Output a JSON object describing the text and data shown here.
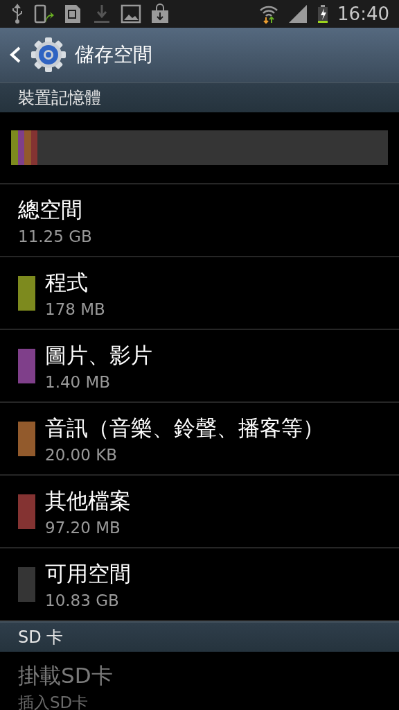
{
  "status_bar": {
    "time": "16:40"
  },
  "header": {
    "title": "儲存空間"
  },
  "sections": [
    {
      "title": "裝置記憶體",
      "total": {
        "label": "總空間",
        "value": "11.25 GB"
      },
      "categories": [
        {
          "label": "程式",
          "value": "178 MB",
          "color": "#7d8a1e",
          "level": 0.018
        },
        {
          "label": "圖片、影片",
          "value": "1.40 MB",
          "color": "#7f3f8a",
          "level": 0.017
        },
        {
          "label": "音訊（音樂、鈴聲、播客等）",
          "value": "20.00 KB",
          "color": "#925a2c",
          "level": 0.018
        },
        {
          "label": "其他檔案",
          "value": "97.20 MB",
          "color": "#843332",
          "level": 0.017
        },
        {
          "label": "可用空間",
          "value": "10.83 GB",
          "color": "#353535"
        }
      ]
    },
    {
      "title": "SD 卡",
      "actions": [
        {
          "label": "掛載SD卡",
          "value": "插入SD卡",
          "disabled": true
        }
      ]
    }
  ]
}
